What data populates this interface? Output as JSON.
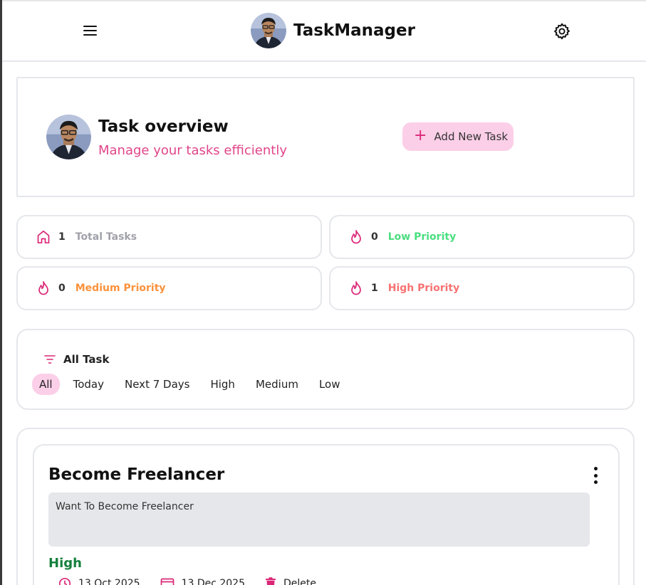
{
  "header": {
    "brand_name": "TaskManager",
    "menu_icon": "hamburger-menu-icon",
    "settings_icon": "gear-icon"
  },
  "overview": {
    "title": "Task overview",
    "subtitle": "Manage your tasks efficiently",
    "add_button_label": "Add New Task"
  },
  "stats": [
    {
      "count": "1",
      "label": "Total Tasks",
      "icon": "home-icon",
      "color": "#a1a1aa"
    },
    {
      "count": "0",
      "label": "Low Priority",
      "icon": "flame-icon",
      "color": "#4ade80"
    },
    {
      "count": "0",
      "label": "Medium Priority",
      "icon": "flame-icon",
      "color": "#fb923c"
    },
    {
      "count": "1",
      "label": "High Priority",
      "icon": "flame-icon",
      "color": "#f87171"
    }
  ],
  "filter": {
    "title": "All Task",
    "tabs": [
      "All",
      "Today",
      "Next 7 Days",
      "High",
      "Medium",
      "Low"
    ],
    "active_tab": "All"
  },
  "tasks": [
    {
      "title": "Become Freelancer",
      "description": "Want To Become Freelancer",
      "priority": "High",
      "created": "13 Oct 2025",
      "due": "13 Dec 2025",
      "delete_label": "Delete"
    }
  ],
  "colors": {
    "accent": "#db2777",
    "accent_light": "#fbcfe8",
    "subtitle_pink": "#e0458a",
    "high_green": "#15803d",
    "border": "#e5e7eb"
  }
}
